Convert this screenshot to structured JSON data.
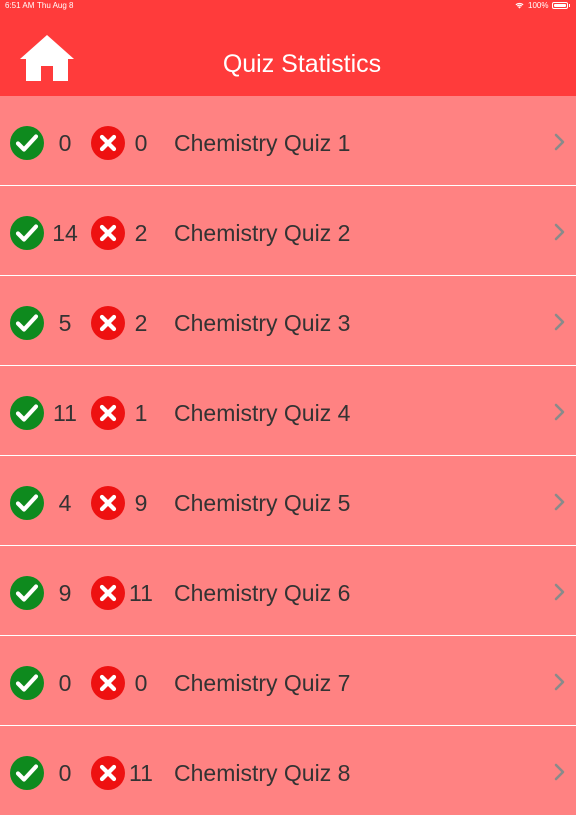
{
  "status_bar": {
    "time": "6:51 AM",
    "date": "Thu Aug 8",
    "battery": "100%"
  },
  "header": {
    "title": "Quiz Statistics",
    "home_icon": "home-icon"
  },
  "colors": {
    "header_bg": "#ff3b3b",
    "list_bg": "#ff8282",
    "correct_icon": "#0e8a1e",
    "wrong_icon": "#ee1111"
  },
  "quizzes": [
    {
      "correct": "0",
      "wrong": "0",
      "name": "Chemistry Quiz 1"
    },
    {
      "correct": "14",
      "wrong": "2",
      "name": "Chemistry Quiz 2"
    },
    {
      "correct": "5",
      "wrong": "2",
      "name": "Chemistry Quiz 3"
    },
    {
      "correct": "11",
      "wrong": "1",
      "name": "Chemistry Quiz 4"
    },
    {
      "correct": "4",
      "wrong": "9",
      "name": "Chemistry Quiz 5"
    },
    {
      "correct": "9",
      "wrong": "11",
      "name": "Chemistry Quiz 6"
    },
    {
      "correct": "0",
      "wrong": "0",
      "name": "Chemistry Quiz 7"
    },
    {
      "correct": "0",
      "wrong": "11",
      "name": "Chemistry Quiz 8"
    }
  ]
}
